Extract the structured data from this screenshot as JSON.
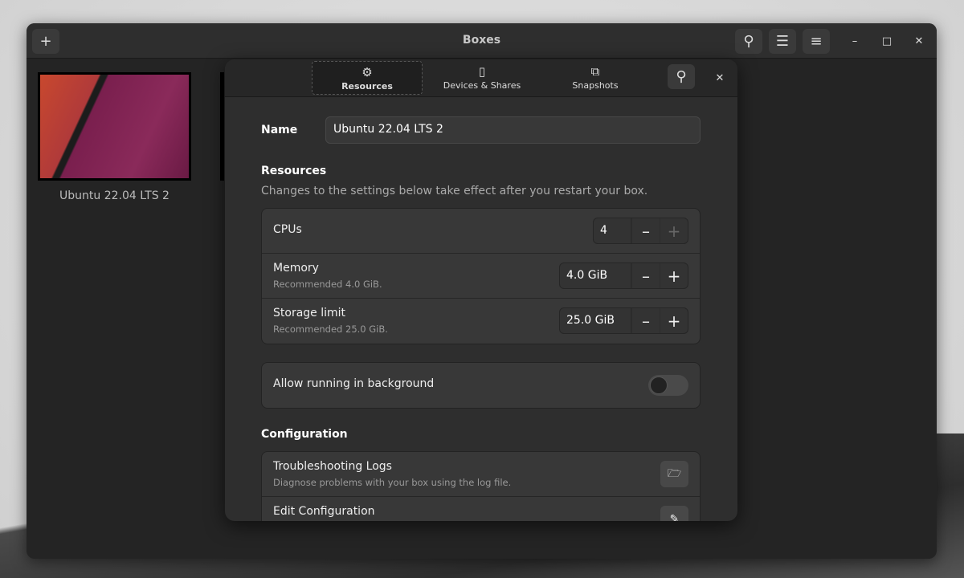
{
  "window": {
    "title": "Boxes",
    "add_icon": "plus-icon"
  },
  "sidebar": {
    "boxes": [
      {
        "name": "Ubuntu 22.04 LTS 2"
      }
    ]
  },
  "dialog": {
    "tabs": [
      {
        "label": "Resources",
        "icon": "gear-icon"
      },
      {
        "label": "Devices & Shares",
        "icon": "mouse-icon"
      },
      {
        "label": "Snapshots",
        "icon": "snapshots-icon"
      }
    ],
    "name_label": "Name",
    "name_value": "Ubuntu 22.04 LTS 2",
    "resources": {
      "heading": "Resources",
      "desc": "Changes to the settings below take effect after you restart your box.",
      "rows": [
        {
          "title": "CPUs",
          "value": "4"
        },
        {
          "title": "Memory",
          "subtitle": "Recommended 4.0 GiB.",
          "value": "4.0 GiB"
        },
        {
          "title": "Storage limit",
          "subtitle": "Recommended 25.0 GiB.",
          "value": "25.0 GiB"
        }
      ]
    },
    "background": {
      "label": "Allow running in background",
      "enabled": false
    },
    "configuration": {
      "heading": "Configuration",
      "rows": [
        {
          "title": "Troubleshooting Logs",
          "subtitle": "Diagnose problems with your box using the log file."
        },
        {
          "title": "Edit Configuration"
        }
      ]
    }
  }
}
